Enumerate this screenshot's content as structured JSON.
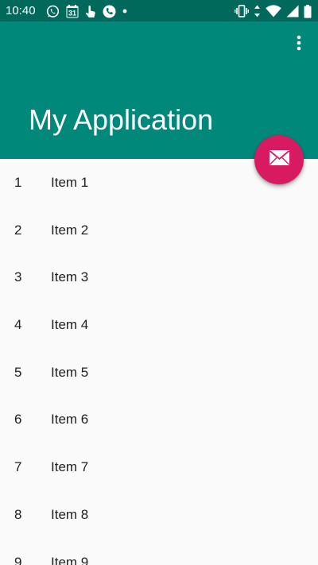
{
  "status_bar": {
    "time": "10:40",
    "left_icons": [
      "whatsapp-icon",
      "calendar-icon",
      "touch-icon",
      "phone-icon",
      "dot-icon"
    ],
    "calendar_day": "31",
    "right_icons": [
      "vibrate-icon",
      "data-arrows-icon",
      "wifi-icon",
      "signal-icon",
      "battery-icon"
    ]
  },
  "app_bar": {
    "title": "My Application",
    "menu_icon": "more-vert-icon"
  },
  "fab": {
    "icon": "email-icon"
  },
  "list": {
    "items": [
      {
        "id": "1",
        "content": "Item 1"
      },
      {
        "id": "2",
        "content": "Item 2"
      },
      {
        "id": "3",
        "content": "Item 3"
      },
      {
        "id": "4",
        "content": "Item 4"
      },
      {
        "id": "5",
        "content": "Item 5"
      },
      {
        "id": "6",
        "content": "Item 6"
      },
      {
        "id": "7",
        "content": "Item 7"
      },
      {
        "id": "8",
        "content": "Item 8"
      },
      {
        "id": "9",
        "content": "Item 9"
      }
    ]
  },
  "colors": {
    "status_bar": "#00695c",
    "primary": "#00897b",
    "accent": "#d81b60",
    "background": "#fafafa",
    "text": "#212121"
  }
}
